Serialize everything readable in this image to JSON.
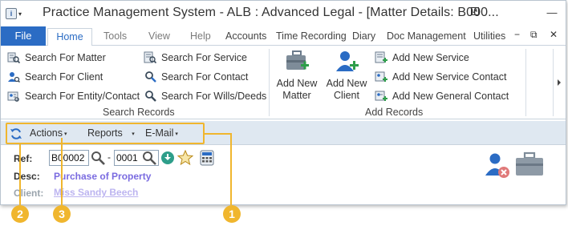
{
  "window": {
    "title": "Practice Management System - ALB : Advanced Legal - [Matter Details: B000..."
  },
  "qat": {
    "icon": "app-icon",
    "caret": "▾"
  },
  "title_buttons": {
    "restore": "⇱",
    "minimize": "—"
  },
  "tabs": [
    {
      "label": "File"
    },
    {
      "label": "Home"
    },
    {
      "label": "Tools"
    },
    {
      "label": "View"
    },
    {
      "label": "Help"
    },
    {
      "label": "Accounts"
    },
    {
      "label": "Time Recording"
    },
    {
      "label": "Diary"
    },
    {
      "label": "Doc Management"
    },
    {
      "label": "Utilities"
    }
  ],
  "tab_controls": {
    "help": "?",
    "minimize": "−",
    "restore": "⧉",
    "close": "✕"
  },
  "search_group": {
    "label": "Search Records",
    "items": [
      {
        "label": "Search For Matter",
        "icon": "matter-search-icon"
      },
      {
        "label": "Search For Client",
        "icon": "client-search-icon"
      },
      {
        "label": "Search For Entity/Contact",
        "icon": "entity-search-icon"
      },
      {
        "label": "Search For Service",
        "icon": "service-search-icon"
      },
      {
        "label": "Search For Contact",
        "icon": "contact-search-icon"
      },
      {
        "label": "Search For Wills/Deeds",
        "icon": "wills-search-icon"
      }
    ]
  },
  "add_group": {
    "label": "Add Records",
    "add_matter": "Add New Matter",
    "add_client": "Add New Client",
    "items": [
      {
        "label": "Add New Service"
      },
      {
        "label": "Add New Service Contact"
      },
      {
        "label": "Add New General Contact"
      }
    ]
  },
  "toolbar": {
    "actions": "Actions",
    "reports": "Reports",
    "email": "E-Mail",
    "caret": "▾"
  },
  "form": {
    "ref_label": "Ref:",
    "ref_value": "B00002",
    "ref_separator": "-",
    "ref_suffix": "0001",
    "desc_label": "Desc:",
    "desc_value": "Purchase of Property",
    "client_label": "Client:",
    "client_value": "Miss Sandy Beech"
  },
  "callouts": [
    "1",
    "2",
    "3"
  ],
  "colors": {
    "accent": "#2b6cc4",
    "highlight": "#f0b62e",
    "toolbar_bg": "#dfe8f1",
    "link": "#7a6be0"
  }
}
